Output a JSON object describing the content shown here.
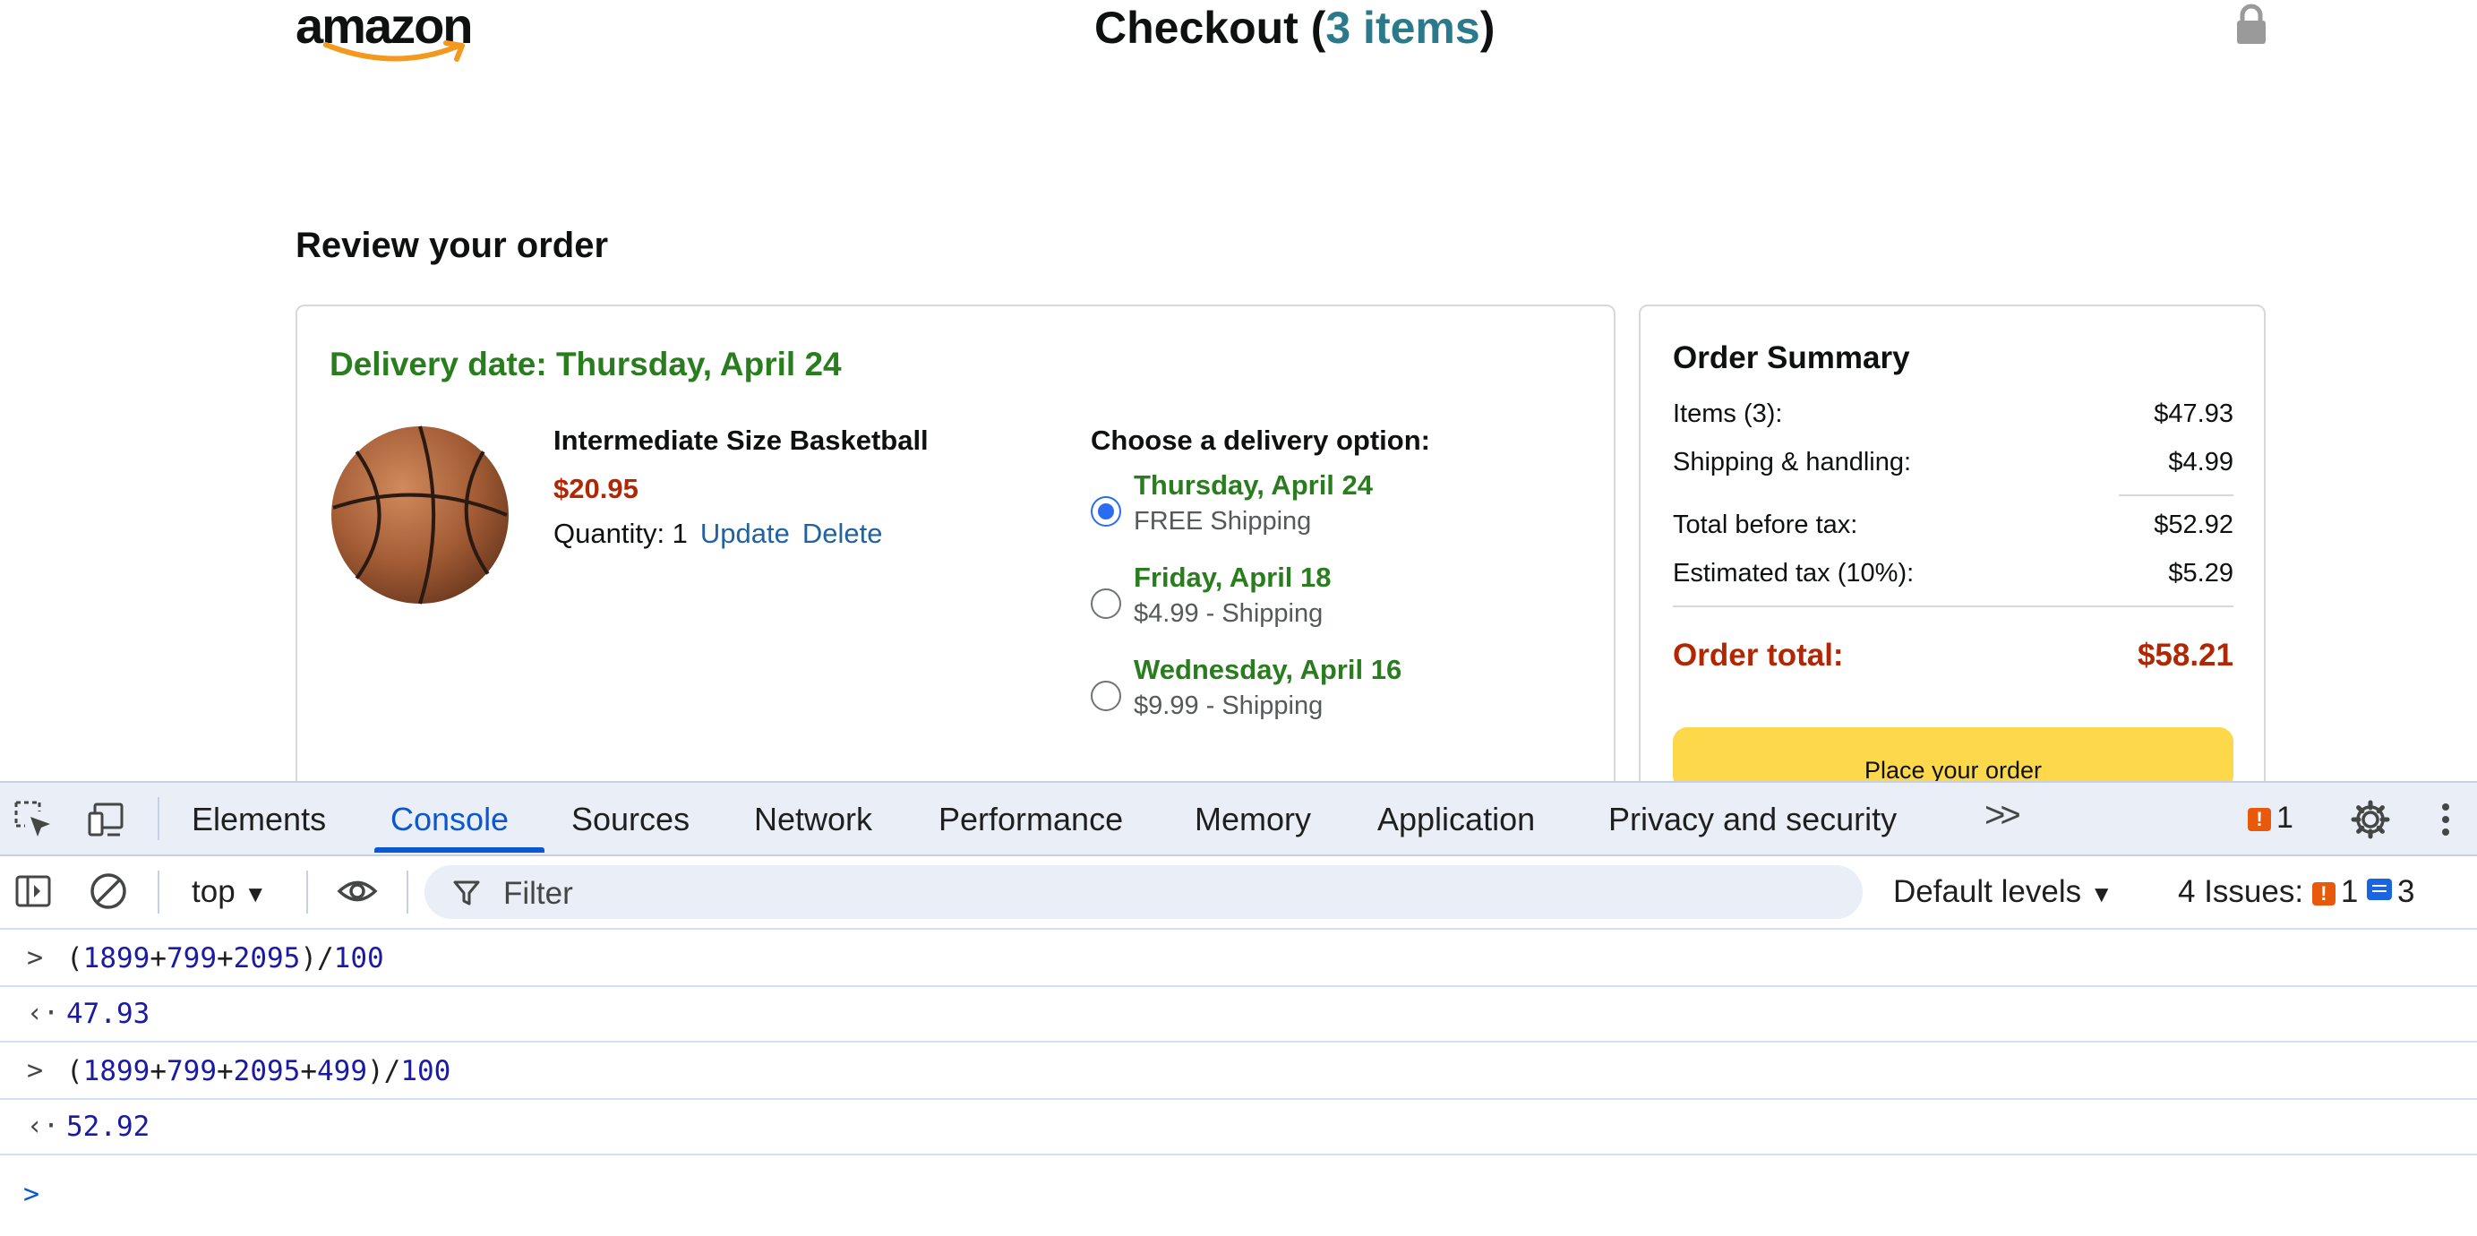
{
  "header": {
    "logo_text": "amazon",
    "title_prefix": "Checkout (",
    "items_link": "3 items",
    "title_suffix": ")",
    "lock_icon": "lock-icon"
  },
  "review": {
    "heading": "Review your order",
    "delivery_date": "Delivery date: Thursday, April 24",
    "product": {
      "name": "Intermediate Size Basketball",
      "price": "$20.95",
      "quantity_label": "Quantity: 1",
      "update_link": "Update",
      "delete_link": "Delete"
    },
    "options_title": "Choose a delivery option:",
    "options": [
      {
        "date": "Thursday, April 24",
        "shipping": "FREE Shipping",
        "selected": true
      },
      {
        "date": "Friday, April 18",
        "shipping": "$4.99 - Shipping",
        "selected": false
      },
      {
        "date": "Wednesday, April 16",
        "shipping": "$9.99 - Shipping",
        "selected": false
      }
    ]
  },
  "summary": {
    "title": "Order Summary",
    "rows": [
      {
        "label": "Items (3):",
        "value": "$47.93"
      },
      {
        "label": "Shipping & handling:",
        "value": "$4.99"
      },
      {
        "label": "Total before tax:",
        "value": "$52.92"
      },
      {
        "label": "Estimated tax (10%):",
        "value": "$5.29"
      }
    ],
    "total_label": "Order total:",
    "total_value": "$58.21",
    "place_order": "Place your order"
  },
  "devtools": {
    "tabs": [
      "Elements",
      "Console",
      "Sources",
      "Network",
      "Performance",
      "Memory",
      "Application",
      "Privacy and security"
    ],
    "active_tab": "Console",
    "more_tabs": ">>",
    "issue_count": "1",
    "context": "top",
    "filter_placeholder": "Filter",
    "levels": "Default levels",
    "issues_label": "4 Issues:",
    "issues_warn": "1",
    "issues_info": "3",
    "console": [
      {
        "type": "input",
        "text": "(1899+799+2095)/100"
      },
      {
        "type": "output",
        "text": "47.93"
      },
      {
        "type": "input",
        "text": "(1899+799+2095+499)/100"
      },
      {
        "type": "output",
        "text": "52.92"
      }
    ],
    "prompt": ">"
  },
  "colors": {
    "green": "#2a7d1e",
    "price_red": "#b12704",
    "link_blue": "#2162a1",
    "teal": "#2a7a8c",
    "button_yellow": "#fcd84a",
    "devtools_blue": "#0b57d0"
  }
}
